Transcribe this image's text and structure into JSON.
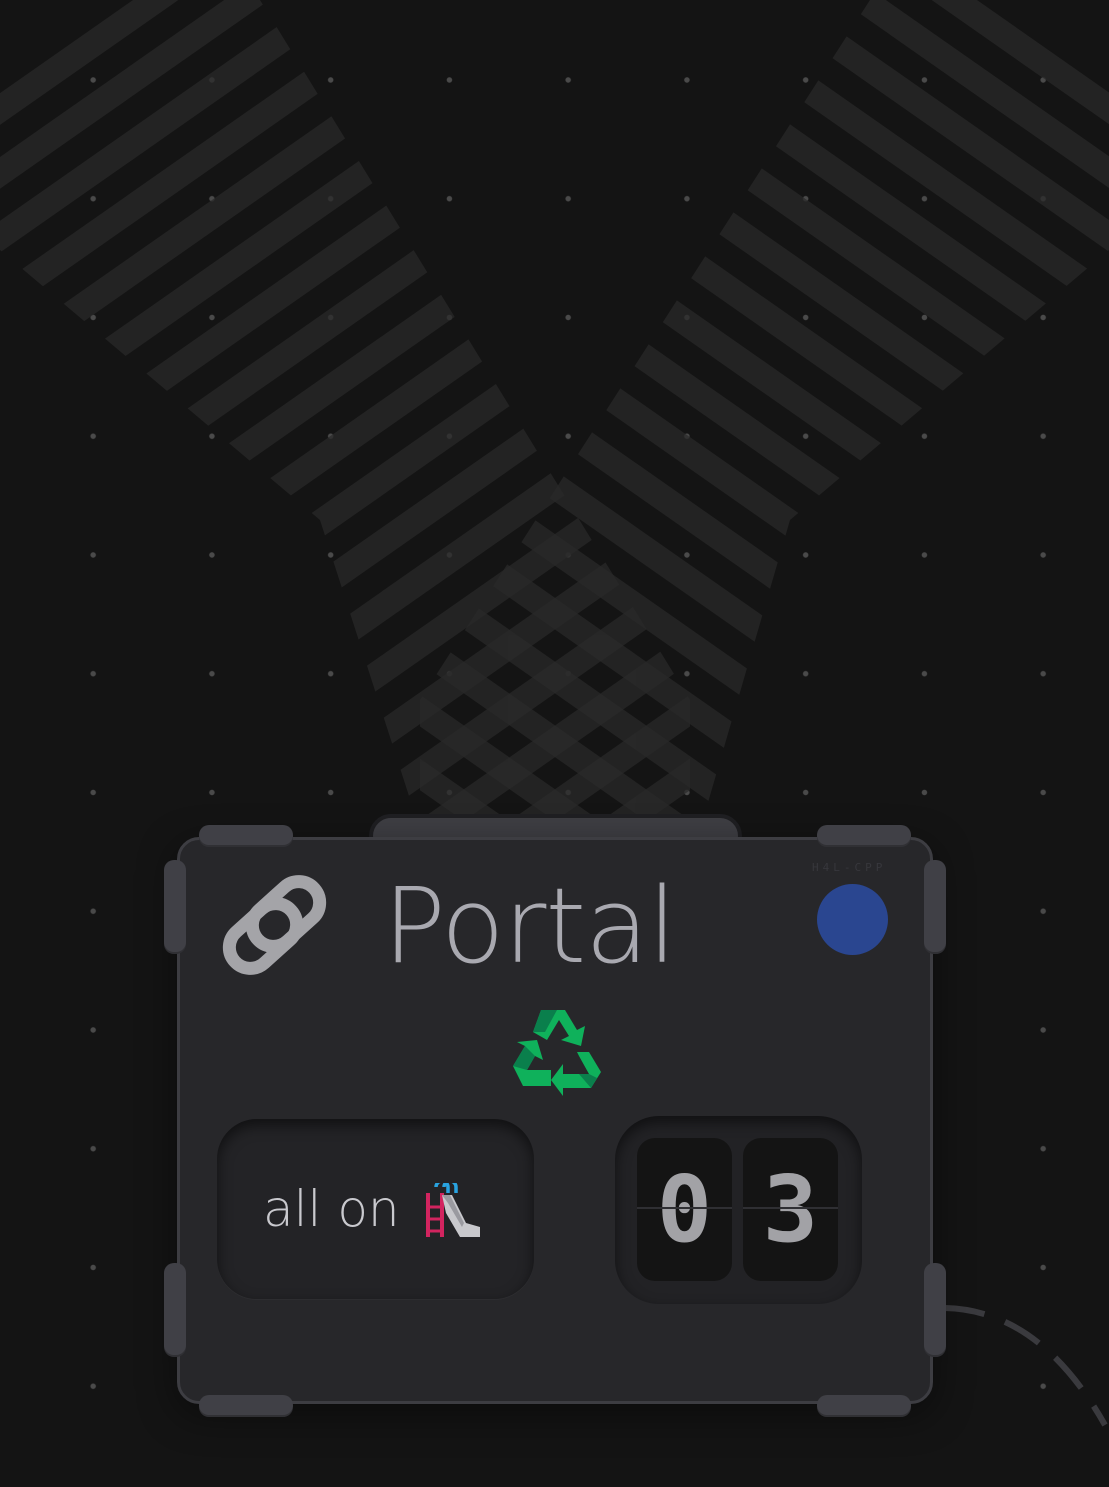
{
  "badge": {
    "title": "Portal",
    "serial": "H4L-CPP",
    "status_color": "#2a4690",
    "title_icon": "link-icon",
    "center_icon": "recycle-icon"
  },
  "mode_button": {
    "label": "all on",
    "icon": "playground-slide-icon"
  },
  "counter": {
    "digits": [
      "0",
      "3"
    ]
  }
}
